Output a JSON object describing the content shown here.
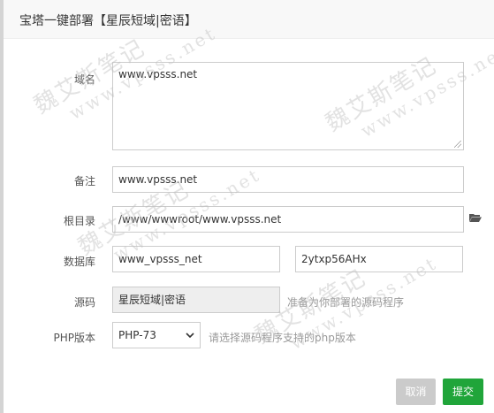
{
  "dialog": {
    "title": "宝塔一键部署【星辰短域|密语】"
  },
  "form": {
    "domain": {
      "label": "域名",
      "value": "www.vpsss.net"
    },
    "remark": {
      "label": "备注",
      "value": "www.vpsss.net"
    },
    "root": {
      "label": "根目录",
      "value": "/www/wwwroot/www.vpsss.net",
      "icon": "folder-open-icon"
    },
    "database": {
      "label": "数据库",
      "name": "www_vpsss_net",
      "password": "2ytxp56AHx"
    },
    "source": {
      "label": "源码",
      "value": "星辰短域|密语",
      "hint": "准备为你部署的源码程序"
    },
    "php": {
      "label": "PHP版本",
      "selected": "PHP-73",
      "hint": "请选择源码程序支持的php版本"
    }
  },
  "buttons": {
    "cancel": "取消",
    "submit": "提交"
  },
  "watermark": {
    "cn": "魏艾斯笔记",
    "en": "www.vpsss.net"
  },
  "colors": {
    "accent": "#20a53a",
    "cancel": "#cbcbcb"
  }
}
